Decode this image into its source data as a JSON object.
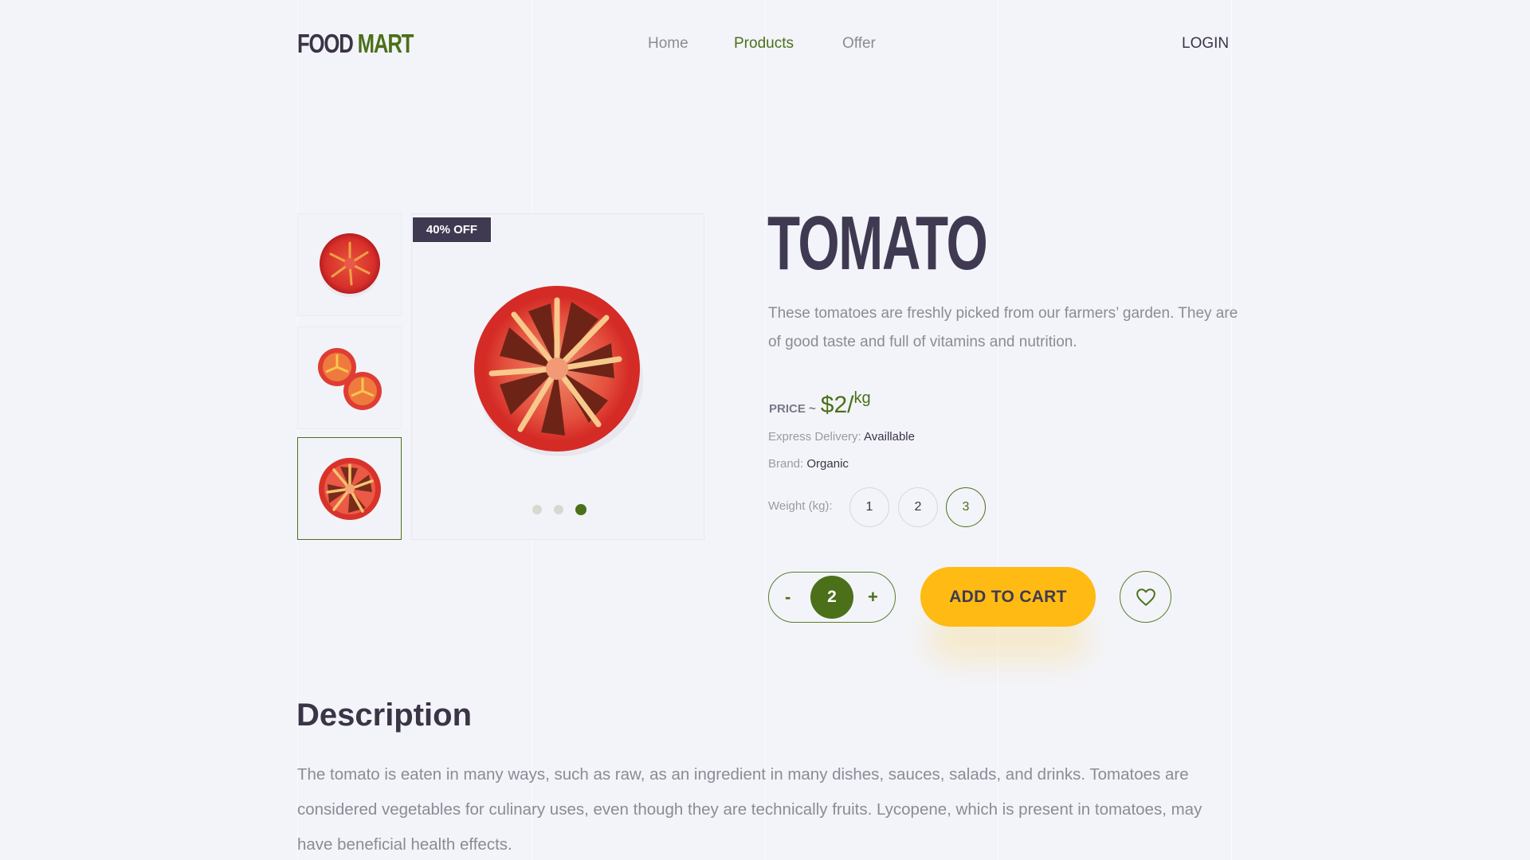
{
  "header": {
    "logo_part1": "FOOD",
    "logo_part2": "MART",
    "nav": [
      {
        "label": "Home",
        "active": false
      },
      {
        "label": "Products",
        "active": true
      },
      {
        "label": "Offer",
        "active": false
      }
    ],
    "login_label": "LOGIN"
  },
  "gallery": {
    "thumbnails": [
      {
        "name": "tomato-half",
        "selected": false
      },
      {
        "name": "cherry-tomato-halves",
        "selected": false
      },
      {
        "name": "tomato-slice",
        "selected": true
      }
    ],
    "badge": "40% OFF",
    "dots": [
      false,
      false,
      true
    ],
    "active_index": 3,
    "total_slides": 3
  },
  "product": {
    "title": "TOMATO",
    "lead": "These tomatoes are freshly picked from our farmers’ garden. They are of good taste and full of vitamins and nutrition.",
    "price_label": "PRICE ~",
    "price_value": "$2/",
    "price_unit": "kg",
    "delivery_label": "Express Delivery:",
    "delivery_value": "Availlable",
    "brand_label": "Brand:",
    "brand_value": "Organic",
    "weight_label": "Weight (kg):",
    "weights": [
      "1",
      "2",
      "3"
    ],
    "selected_weight": "3",
    "qty_minus": "-",
    "qty_value": "2",
    "qty_plus": "+",
    "add_to_cart": "ADD TO CART",
    "wishlist_icon": "heart-icon"
  },
  "description": {
    "heading": "Description",
    "text": "The tomato is eaten in many ways, such as raw, as an ingredient in many dishes, sauces, salads, and drinks. Tomatoes are considered vegetables for culinary uses, even though they are technically fruits. Lycopene, which is present in tomatoes, may have beneficial health effects."
  },
  "colors": {
    "brand_green": "#4b7019",
    "accent_yellow": "#ffba13",
    "dark": "#3f3a52",
    "background": "#f3f4f9"
  }
}
